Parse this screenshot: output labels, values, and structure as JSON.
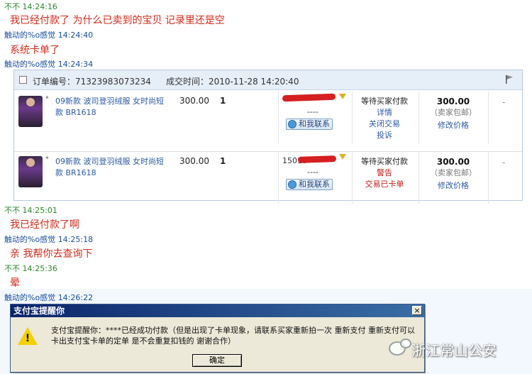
{
  "chat": [
    {
      "sender": "不不",
      "time": "14:24:16",
      "msg": "我已经付款了 为什么已卖到的宝贝 记录里还是空"
    },
    {
      "sender": "触动的%o感觉",
      "time": "14:24:40",
      "msg": "系统卡单了"
    },
    {
      "sender": "触动的%o感觉",
      "time": "14:24:34"
    },
    {
      "sender": "不不",
      "time": "14:25:01",
      "msg": "我已经付款了啊"
    },
    {
      "sender": "触动的%o感觉",
      "time": "14:25:18",
      "msg": "亲 我帮你去查询下"
    },
    {
      "sender": "不不",
      "time": "14:25:36",
      "msg": "晕"
    },
    {
      "sender": "触动的%o感觉",
      "time": "14:26:22"
    }
  ],
  "order": {
    "number_label": "订单编号：71323983073234",
    "date_label": "成交时间：2010-11-28 14:20:40",
    "rows": [
      {
        "title": "09新款 波司登羽绒服 女时尚短款 BR1618",
        "price": "300.00",
        "qty": "1",
        "buyer": "",
        "dashes": "----",
        "contact": "和我联系",
        "status": "等待买家付款",
        "links": [
          "详情",
          "关闭交易",
          "投诉"
        ],
        "amount": "300.00",
        "shipping": "（卖家包邮）",
        "modify": "修改价格",
        "right": "-"
      },
      {
        "title": "09新款 波司登羽绒服 女时尚短款 BR1618",
        "price": "300.00",
        "qty": "1",
        "buyer": "15018",
        "dashes": "----",
        "contact": "和我联系",
        "status": "等待买家付款",
        "alerts": [
          "警告",
          "交易已卡单"
        ],
        "amount": "300.00",
        "shipping": "（卖家包邮）",
        "modify": "修改价格",
        "right": "-"
      }
    ]
  },
  "dialog": {
    "title": "支付宝提醒你",
    "close": "×",
    "text": "支付宝提醒你：****已经成功付款（但是出现了卡单现象，请联系买家重新拍一次 重新支付 重新支付可以卡出支付宝卡单的定单 是不会重复扣钱的 谢谢合作）",
    "ok": "确定"
  },
  "watermark": "浙江常山公安"
}
